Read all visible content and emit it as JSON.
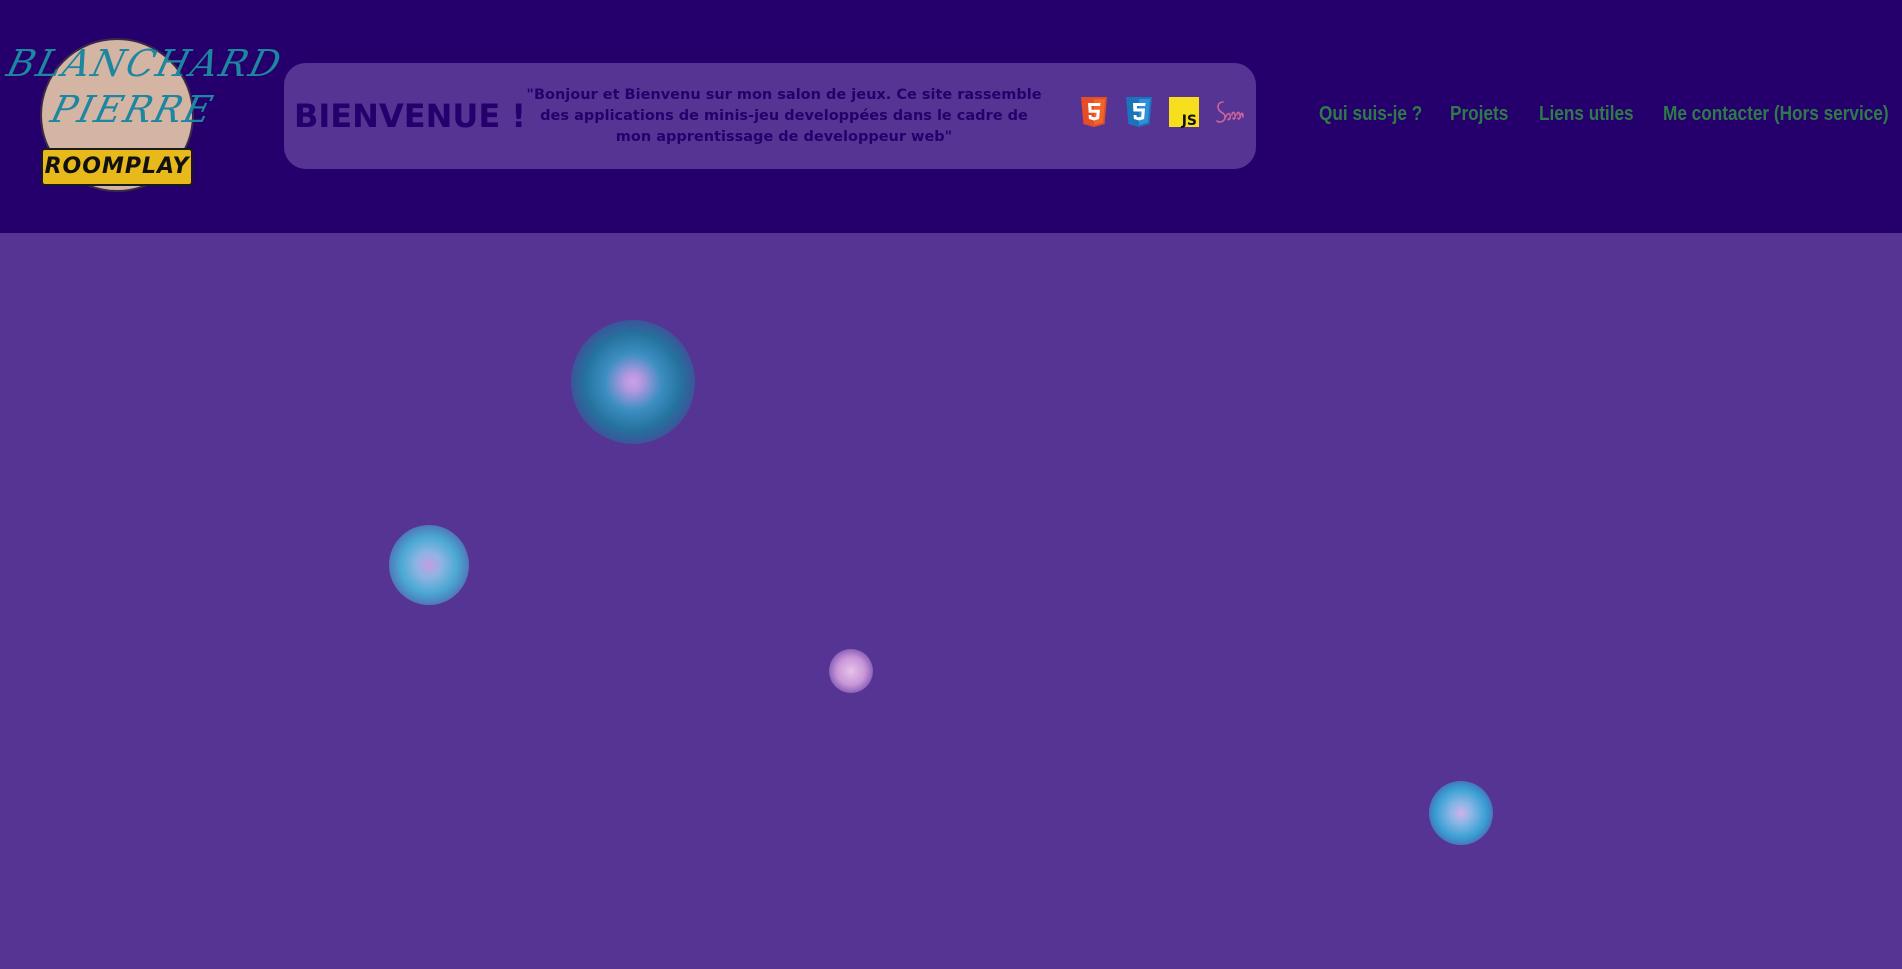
{
  "logo": {
    "line1": "BLANCHARD",
    "line2": "PIERRE",
    "badge": "ROOMPLAY"
  },
  "welcome": {
    "title": "BIENVENUE !",
    "text": "\"Bonjour et Bienvenu sur mon salon de jeux. Ce site rassemble des applications de minis-jeu developpées dans le cadre de mon apprentissage de developpeur web\""
  },
  "tech_icons": [
    "html5-icon",
    "css3-icon",
    "javascript-icon",
    "sass-icon"
  ],
  "nav": {
    "items": [
      {
        "label": "Qui suis-je ?"
      },
      {
        "label": "Projets"
      },
      {
        "label": "Liens utiles"
      },
      {
        "label": "Me contacter (Hors service)"
      }
    ]
  },
  "js_icon_text": "JS",
  "colors": {
    "header_bg": "#25006c",
    "main_bg": "#553494",
    "nav_text": "#2f7a4a",
    "title_text": "#25006c",
    "logo_script": "#1d86a0",
    "logo_badge": "#e8b91b",
    "html5": "#e44d26",
    "css3": "#2f8fdc",
    "js": "#f7df1e",
    "sass": "#cf649a"
  }
}
